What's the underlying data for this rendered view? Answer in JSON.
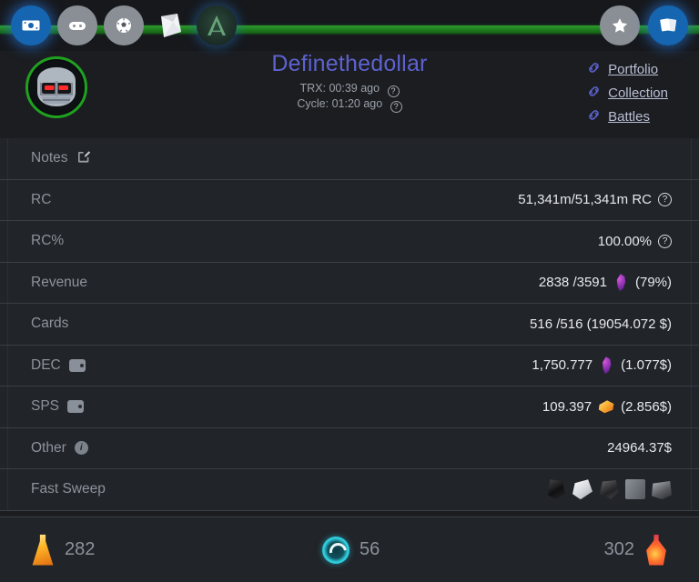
{
  "navbar": {
    "left_icons": [
      {
        "name": "cash-icon",
        "label": "Cash",
        "active": true
      },
      {
        "name": "gamepad-icon",
        "label": "Games",
        "active": false
      },
      {
        "name": "soccer-ball-icon",
        "label": "Battles",
        "active": false
      },
      {
        "name": "pack-icon",
        "label": "Packs",
        "active": false
      },
      {
        "name": "app-logo-icon",
        "label": "A",
        "active": false
      }
    ],
    "right_icons": [
      {
        "name": "star-icon",
        "label": "Favorites"
      },
      {
        "name": "cards-stack-icon",
        "label": "Cards"
      }
    ],
    "progress_color": "#1d7a1d"
  },
  "profile": {
    "avatar_name": "robot-avatar",
    "avatar_ring_color": "#1fa11f",
    "username": "Definethedollar",
    "username_color": "#5d62cf",
    "trx_label": "TRX:",
    "trx_value": "00:39 ago",
    "cycle_label": "Cycle:",
    "cycle_value": "01:20 ago",
    "help_glyph": "?",
    "links": [
      {
        "name": "link-portfolio",
        "label": "Portfolio"
      },
      {
        "name": "link-collection",
        "label": "Collection"
      },
      {
        "name": "link-battles",
        "label": "Battles"
      }
    ]
  },
  "rows": [
    {
      "key": "notes",
      "label": "Notes",
      "left_icon": "edit-icon",
      "value": "",
      "value_icon": ""
    },
    {
      "key": "rc",
      "label": "RC",
      "left_icon": "",
      "value": "51,341m/51,341m RC",
      "value_icon": "question-circle-icon"
    },
    {
      "key": "rc_percent",
      "label": "RC%",
      "left_icon": "",
      "value": "100.00%",
      "value_icon": "question-circle-icon"
    },
    {
      "key": "revenue",
      "label": "Revenue",
      "left_icon": "",
      "value": "2838 /3591",
      "value_icon": "dec-gem-icon",
      "value_suffix": "(79%)"
    },
    {
      "key": "cards",
      "label": "Cards",
      "left_icon": "",
      "value": "516 /516 (19054.072 $)",
      "value_icon": ""
    },
    {
      "key": "dec",
      "label": "DEC",
      "left_icon": "wallet-icon",
      "value": "1,750.777",
      "value_icon": "dec-gem-icon",
      "value_suffix": "(1.077$)"
    },
    {
      "key": "sps",
      "label": "SPS",
      "left_icon": "wallet-icon",
      "value": "109.397",
      "value_icon": "sps-token-icon",
      "value_suffix": "(2.856$)"
    },
    {
      "key": "other",
      "label": "Other",
      "left_icon": "info-circle-icon",
      "value": "24964.37$",
      "value_icon": ""
    },
    {
      "key": "fast_sweep",
      "label": "Fast Sweep",
      "left_icon": "",
      "value": "",
      "value_icon": "sweep-icons",
      "sweep_items": [
        "sweep-dark-pack-icon",
        "sweep-white-pack-icon",
        "sweep-crumpled-pack-icon",
        "sweep-card-icon",
        "sweep-chest-icon"
      ]
    }
  ],
  "potions": [
    {
      "name": "legendary-potion",
      "icon": "gold-potion-icon",
      "count": "282",
      "align": "left"
    },
    {
      "name": "energy-spiral",
      "icon": "spiral-energy-icon",
      "count": "56",
      "align": "mid"
    },
    {
      "name": "alchemy-potion",
      "icon": "red-potion-icon",
      "count": "302",
      "align": "right"
    }
  ]
}
